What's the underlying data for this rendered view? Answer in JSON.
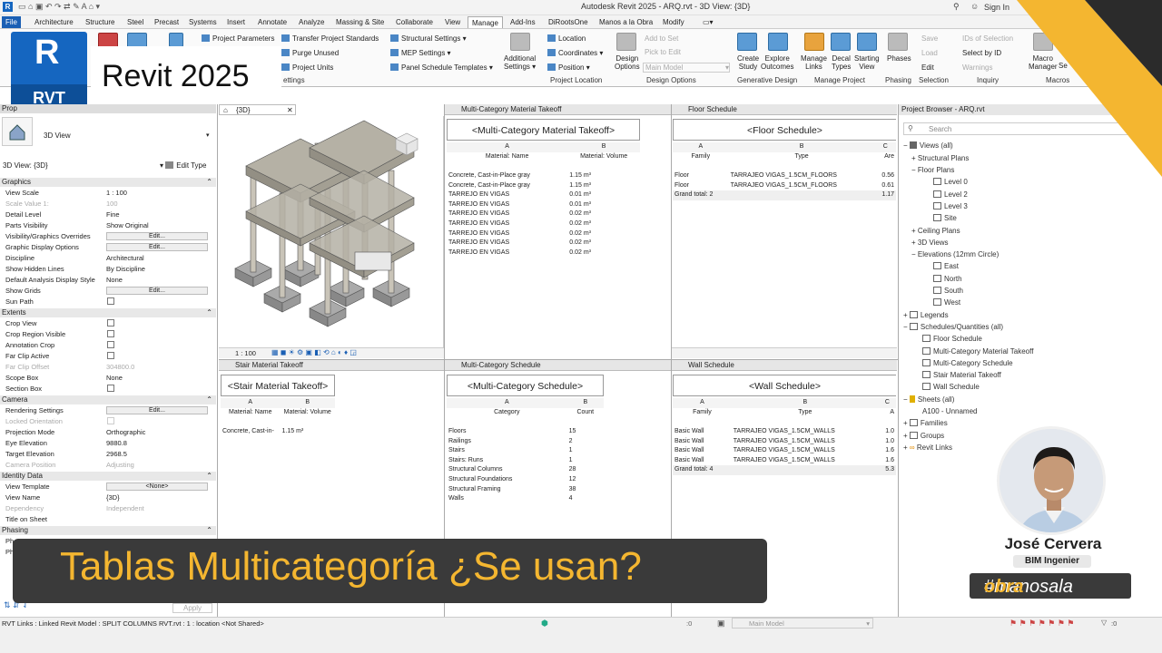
{
  "titlebar": {
    "title": "Autodesk Revit 2025 - ARQ.rvt - 3D View: {3D}",
    "sign_in": "Sign In"
  },
  "tabs": [
    "File",
    "Architecture",
    "Structure",
    "Steel",
    "Precast",
    "Systems",
    "Insert",
    "Annotate",
    "Analyze",
    "Massing & Site",
    "Collaborate",
    "View",
    "Manage",
    "Add-Ins",
    "DiRootsOne",
    "Manos a la Obra",
    "Modify"
  ],
  "ribbon": {
    "settings_items": [
      "Project  Parameters",
      "Transfer  Project Standards",
      "Purge  Unused",
      "Project  Units"
    ],
    "settings_label": "ettings",
    "structural_settings": "Structural  Settings",
    "mep_settings": "MEP  Settings",
    "panel_schedule_templates": "Panel Schedule  Templates",
    "additional_settings": [
      "Additional",
      "Settings"
    ],
    "location": "Location",
    "coordinates": "Coordinates",
    "position": "Position",
    "project_location_label": "Project Location",
    "design_options": [
      "Design",
      "Options"
    ],
    "add_to_set": "Add to Set",
    "pick_to_edit": "Pick to Edit",
    "main_model": "Main Model",
    "design_options_label": "Design Options",
    "create_study": [
      "Create",
      "Study"
    ],
    "explore_outcomes": [
      "Explore",
      "Outcomes"
    ],
    "generative_design_label": "Generative Design",
    "manage_links": [
      "Manage",
      "Links"
    ],
    "decal_types": [
      "Decal",
      "Types"
    ],
    "starting_view": [
      "Starting",
      "View"
    ],
    "manage_project_label": "Manage Project",
    "phases": "Phases",
    "phasing_label": "Phasing",
    "save": "Save",
    "load": "Load",
    "edit": "Edit",
    "selection_label": "Selection",
    "ids_of_selection": "IDs of  Selection",
    "select_by_id": "Select  by ID",
    "warnings": "Warnings",
    "inquiry_label": "Inquiry",
    "macro_manager": [
      "Macro",
      "Manager"
    ],
    "macros_label": "Macros",
    "macro_se": "Se"
  },
  "logo": {
    "letter": "R",
    "badge": "RVT",
    "product": "Revit 2025"
  },
  "properties": {
    "header": "Prop",
    "type_name": "3D View",
    "selector": "3D View: {3D}",
    "edit_type": "Edit Type",
    "groups": {
      "graphics": "Graphics",
      "extents": "Extents",
      "camera": "Camera",
      "identity": "Identity Data",
      "phasing": "Phasing"
    },
    "rows": {
      "view_scale": [
        "View Scale",
        "1 : 100"
      ],
      "scale_value": [
        "Scale Value    1:",
        "100"
      ],
      "detail_level": [
        "Detail Level",
        "Fine"
      ],
      "parts_visibility": [
        "Parts Visibility",
        "Show Original"
      ],
      "vg_overrides": "Visibility/Graphics Overrides",
      "graphic_display": "Graphic Display Options",
      "discipline": [
        "Discipline",
        "Architectural"
      ],
      "hidden_lines": [
        "Show Hidden Lines",
        "By Discipline"
      ],
      "analysis_style": [
        "Default Analysis Display Style",
        "None"
      ],
      "show_grids": "Show Grids",
      "sun_path": "Sun Path",
      "crop_view": "Crop View",
      "crop_visible": "Crop Region Visible",
      "annotation_crop": "Annotation Crop",
      "far_clip_active": "Far Clip Active",
      "far_clip_offset": [
        "Far Clip Offset",
        "304800.0"
      ],
      "scope_box": [
        "Scope Box",
        "None"
      ],
      "section_box": "Section Box",
      "rendering": "Rendering Settings",
      "locked_orient": "Locked Orientation",
      "projection": [
        "Projection Mode",
        "Orthographic"
      ],
      "eye_elev": [
        "Eye Elevation",
        "9880.8"
      ],
      "target_elev": [
        "Target Elevation",
        "2968.5"
      ],
      "camera_pos": [
        "Camera Position",
        "Adjusting"
      ],
      "view_template": [
        "View Template",
        "<None>"
      ],
      "view_name": [
        "View Name",
        "{3D}"
      ],
      "dependency": [
        "Dependency",
        "Independent"
      ],
      "title_on_sheet": "Title on Sheet",
      "ph1": "Ph",
      "ph2": "Ph"
    },
    "edit_label": "Edit...",
    "apply": "Apply"
  },
  "view3d": {
    "tab": "{3D}",
    "scale": "1 : 100"
  },
  "schedules": {
    "mcmt": {
      "tab": "Multi-Category Material Takeoff",
      "title": "<Multi-Category Material Takeoff>",
      "cols": [
        "A",
        "B"
      ],
      "headers": [
        "Material: Name",
        "Material: Volume"
      ],
      "rows": [
        [
          "Concrete, Cast-in-Place gray",
          "1.15 m³"
        ],
        [
          "Concrete, Cast-in-Place gray",
          "1.15 m³"
        ],
        [
          "TARREJO EN VIGAS",
          "0.01 m³"
        ],
        [
          "TARREJO EN VIGAS",
          "0.01 m³"
        ],
        [
          "TARREJO EN VIGAS",
          "0.02 m³"
        ],
        [
          "TARREJO EN VIGAS",
          "0.02 m³"
        ],
        [
          "TARREJO EN VIGAS",
          "0.02 m³"
        ],
        [
          "TARREJO EN VIGAS",
          "0.02 m³"
        ],
        [
          "TARREJO EN VIGAS",
          "0.02 m³"
        ]
      ]
    },
    "floor": {
      "tab": "Floor Schedule",
      "title": "<Floor Schedule>",
      "cols": [
        "A",
        "B",
        "C"
      ],
      "headers": [
        "Family",
        "Type",
        "Are"
      ],
      "rows": [
        [
          "Floor",
          "TARRAJEO VIGAS_1.5CM_FLOORS",
          "0.56"
        ],
        [
          "Floor",
          "TARRAJEO VIGAS_1.5CM_FLOORS",
          "0.61"
        ],
        [
          "Grand total: 2",
          "",
          "1.17"
        ]
      ]
    },
    "stair": {
      "tab": "Stair Material Takeoff",
      "title": "<Stair Material Takeoff>",
      "cols": [
        "A",
        "B"
      ],
      "headers": [
        "Material: Name",
        "Material: Volume"
      ],
      "rows": [
        [
          "Concrete, Cast-in-",
          "1.15 m³"
        ]
      ]
    },
    "mcs": {
      "tab": "Multi-Category Schedule",
      "title": "<Multi-Category Schedule>",
      "cols": [
        "A",
        "B"
      ],
      "headers": [
        "Category",
        "Count"
      ],
      "rows": [
        [
          "Floors",
          "15"
        ],
        [
          "Railings",
          "2"
        ],
        [
          "Stairs",
          "1"
        ],
        [
          "Stairs: Runs",
          "1"
        ],
        [
          "Structural Columns",
          "28"
        ],
        [
          "Structural Foundations",
          "12"
        ],
        [
          "Structural Framing",
          "38"
        ],
        [
          "Walls",
          "4"
        ]
      ]
    },
    "wall": {
      "tab": "Wall Schedule",
      "title": "<Wall Schedule>",
      "cols": [
        "A",
        "B",
        "C"
      ],
      "headers": [
        "Family",
        "Type",
        "A"
      ],
      "rows": [
        [
          "Basic Wall",
          "TARRAJEO VIGAS_1.5CM_WALLS",
          "1.0"
        ],
        [
          "Basic Wall",
          "TARRAJEO VIGAS_1.5CM_WALLS",
          "1.0"
        ],
        [
          "Basic Wall",
          "TARRAJEO VIGAS_1.5CM_WALLS",
          "1.6"
        ],
        [
          "Basic Wall",
          "TARRAJEO VIGAS_1.5CM_WALLS",
          "1.6"
        ],
        [
          "Grand total: 4",
          "",
          "5.3"
        ]
      ]
    }
  },
  "browser": {
    "title": "Project Browser - ARQ.rvt",
    "search_placeholder": "Search",
    "items": [
      "Views (all)",
      "Structural Plans",
      "Floor Plans",
      "Level 0",
      "Level 2",
      "Level 3",
      "Site",
      "Ceiling Plans",
      "3D Views",
      "Elevations (12mm Circle)",
      "East",
      "North",
      "South",
      "West",
      "Legends",
      "Schedules/Quantities (all)",
      "Floor Schedule",
      "Multi-Category Material Takeoff",
      "Multi-Category Schedule",
      "Stair Material Takeoff",
      "Wall Schedule",
      "Sheets (all)",
      "A100 - Unnamed",
      "Families",
      "Groups",
      "Revit Links"
    ]
  },
  "status": {
    "text": "RVT Links : Linked Revit Model : SPLIT COLUMNS RVT.rvt : 1 : location <Not Shared>",
    "model": "Main Model",
    "zero": ":0"
  },
  "overlay": {
    "banner": "Tablas Multicategoría ¿Se usan?",
    "name": "José Cervera",
    "role": "BIM Ingenier",
    "hashtag_pre": "#manosala",
    "hashtag_bold": "obra"
  },
  "colors": {
    "accent": "#f4b630",
    "revit_blue": "#1566c0",
    "banner_bg": "#3a3a3a"
  }
}
